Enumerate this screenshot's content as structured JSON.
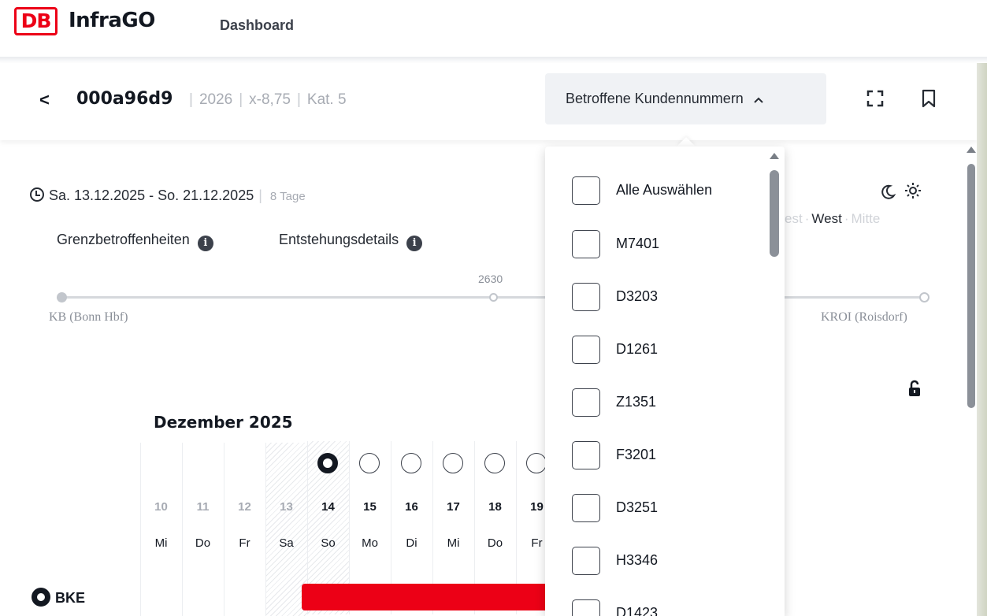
{
  "app": {
    "logo_text": "DB",
    "brand": "InfraGO",
    "nav_dashboard": "Dashboard"
  },
  "header": {
    "back_glyph": "<",
    "train_id": "000a96d9",
    "meta": [
      "2026",
      "x-8,75",
      "Kat. 5"
    ],
    "dropdown_label": "Betroffene Kundennummern",
    "dropdown_chevron": "^",
    "icons": [
      "fullscreen-icon",
      "bookmark-icon"
    ]
  },
  "period": {
    "range": "Sa. 13.12.2025 - So. 21.12.2025",
    "days": "8 Tage"
  },
  "links": {
    "grenz": "Grenzbetroffenheiten",
    "entstehung": "Entstehungsdetails"
  },
  "route": {
    "start": "KB (Bonn Hbf)",
    "mid_km": "2630",
    "end": "KROI (Roisdorf)"
  },
  "region": {
    "prev": "lwest",
    "active": "West",
    "next": "Mitte"
  },
  "calendar": {
    "month": "Dezember 2025",
    "days": [
      {
        "num": "10",
        "name": "Mi"
      },
      {
        "num": "11",
        "name": "Do"
      },
      {
        "num": "12",
        "name": "Fr"
      },
      {
        "num": "13",
        "name": "Sa"
      },
      {
        "num": "14",
        "name": "So"
      },
      {
        "num": "15",
        "name": "Mo"
      },
      {
        "num": "16",
        "name": "Di"
      },
      {
        "num": "17",
        "name": "Mi"
      },
      {
        "num": "18",
        "name": "Do"
      },
      {
        "num": "19",
        "name": "Fr"
      }
    ]
  },
  "row_label": "BKE",
  "customer_dropdown": {
    "select_all": "Alle Auswählen",
    "options": [
      "M7401",
      "D3203",
      "D1261",
      "Z1351",
      "F3201",
      "D3251",
      "H3346",
      "D1423"
    ]
  },
  "colors": {
    "accent_red": "#ec0016",
    "text": "#131821",
    "muted": "#a7abb3"
  }
}
